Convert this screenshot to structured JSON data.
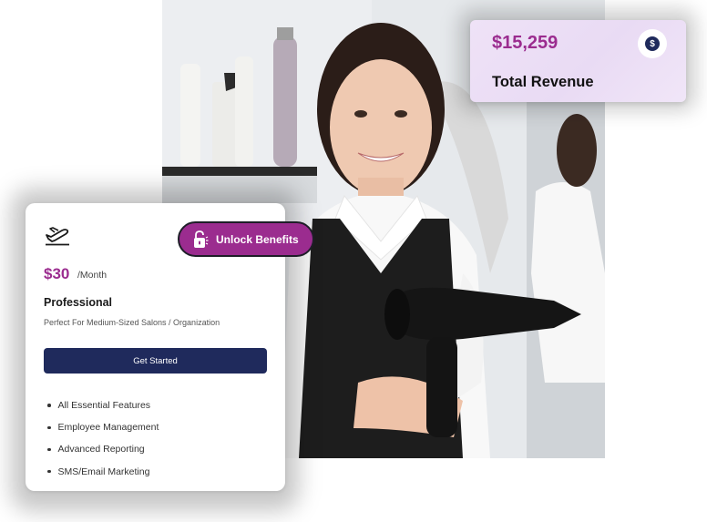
{
  "revenue": {
    "amount": "$15,259",
    "label": "Total Revenue",
    "icon": "dollar-icon",
    "icon_glyph": "$"
  },
  "pricing": {
    "icon": "airplane-takeoff-icon",
    "price": "$30",
    "period": "/Month",
    "plan_name": "Professional",
    "description": "Perfect For Medium-Sized Salons / Organization",
    "cta_label": "Get Started",
    "features": [
      "All Essential Features",
      "Employee Management",
      "Advanced Reporting",
      "SMS/Email Marketing"
    ]
  },
  "unlock": {
    "icon": "unlock-icon",
    "label": "Unlock Benefits"
  },
  "colors": {
    "brand_purple": "#9b2c8f",
    "navy": "#1f2a5c",
    "revenue_card_bg": "#ece0f6"
  }
}
